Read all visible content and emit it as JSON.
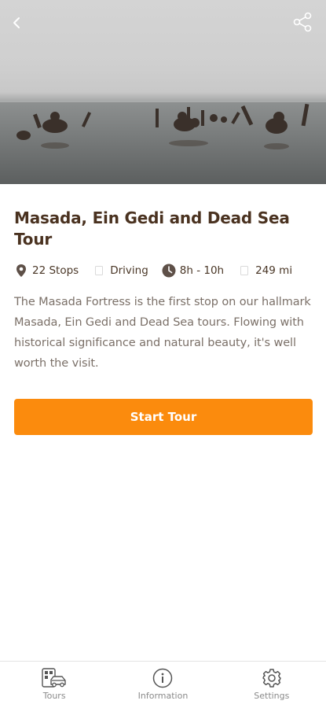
{
  "hero": {
    "image_alt": "People floating in the Dead Sea",
    "back_icon": "chevron-left-icon",
    "share_icon": "share-icon"
  },
  "tour": {
    "title": "Masada, Ein Gedi and Dead Sea Tour",
    "stops": "22 Stops",
    "mode": "Driving",
    "duration": "8h - 10h",
    "distance": "249 mi",
    "description": "The Masada Fortress is the first stop on our hallmark Masada, Ein Gedi and Dead Sea tours. Flowing with historical significance and natural beauty, it's well worth the visit.",
    "start_label": "Start Tour"
  },
  "nav": {
    "tours": "Tours",
    "information": "Information",
    "settings": "Settings"
  },
  "colors": {
    "accent": "#fb8b0d",
    "title": "#4a3220",
    "body_text": "#7b7068",
    "nav_text": "#8a8a8a"
  }
}
